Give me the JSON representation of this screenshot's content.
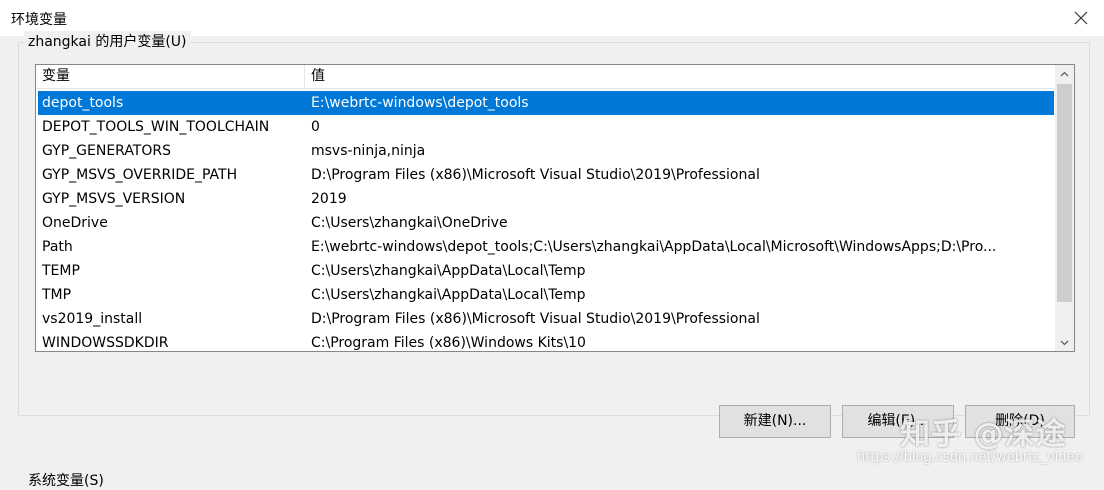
{
  "window": {
    "title": "环境变量",
    "close_icon": "close-icon"
  },
  "user_vars": {
    "group_label": "zhangkai 的用户变量(U)",
    "columns": {
      "name": "变量",
      "value": "值"
    },
    "rows": [
      {
        "name": "depot_tools",
        "value": "E:\\webrtc-windows\\depot_tools",
        "selected": true
      },
      {
        "name": "DEPOT_TOOLS_WIN_TOOLCHAIN",
        "value": "0"
      },
      {
        "name": "GYP_GENERATORS",
        "value": "msvs-ninja,ninja"
      },
      {
        "name": "GYP_MSVS_OVERRIDE_PATH",
        "value": "D:\\Program Files (x86)\\Microsoft Visual Studio\\2019\\Professional"
      },
      {
        "name": "GYP_MSVS_VERSION",
        "value": "2019"
      },
      {
        "name": "OneDrive",
        "value": "C:\\Users\\zhangkai\\OneDrive"
      },
      {
        "name": "Path",
        "value": "E:\\webrtc-windows\\depot_tools;C:\\Users\\zhangkai\\AppData\\Local\\Microsoft\\WindowsApps;D:\\Pro..."
      },
      {
        "name": "TEMP",
        "value": "C:\\Users\\zhangkai\\AppData\\Local\\Temp"
      },
      {
        "name": "TMP",
        "value": "C:\\Users\\zhangkai\\AppData\\Local\\Temp"
      },
      {
        "name": "vs2019_install",
        "value": "D:\\Program Files (x86)\\Microsoft Visual Studio\\2019\\Professional"
      },
      {
        "name": "WINDOWSSDKDIR",
        "value": "C:\\Program Files (x86)\\Windows Kits\\10"
      }
    ],
    "buttons": {
      "new": "新建(N)...",
      "edit": "编辑(E)...",
      "delete": "删除(D)"
    }
  },
  "system_vars": {
    "group_label": "系统变量(S)"
  },
  "watermark": {
    "text": "知乎 @深途",
    "url": "https://blog.csdn.net/webrtc_video"
  },
  "colors": {
    "selection": "#0078d7",
    "background": "#f0f0f0"
  }
}
